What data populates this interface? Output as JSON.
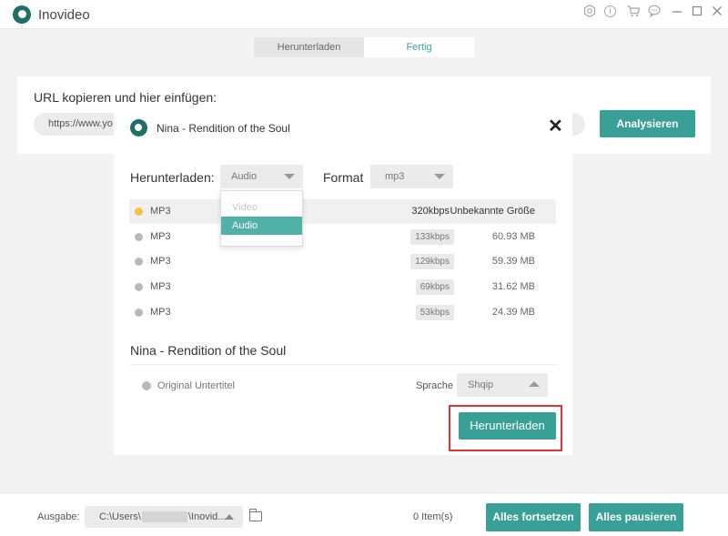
{
  "app": {
    "title": "Inovideo",
    "brand_color": "#39a097",
    "window_icons": [
      "settings-icon",
      "info-icon",
      "cart-icon",
      "feedback-icon",
      "minimize-icon",
      "maximize-icon",
      "close-icon"
    ]
  },
  "tabs": [
    {
      "label": "Herunterladen",
      "active": false
    },
    {
      "label": "Fertig",
      "active": true
    }
  ],
  "url_panel": {
    "label": "URL kopieren und hier einfügen:",
    "url_value": "https://www.yo",
    "analyze_label": "Analysieren"
  },
  "dialog": {
    "title": "Nina - Rendition of the Soul",
    "download_label": "Herunterladen:",
    "type_select": "Audio",
    "type_options": [
      "Video",
      "Audio"
    ],
    "format_label": "Format",
    "format_select": "mp3",
    "rows": [
      {
        "format": "MP3",
        "bitrate": "320kbps",
        "size": "Unbekannte Größe",
        "selected": true
      },
      {
        "format": "MP3",
        "bitrate": "133kbps",
        "size": "60.93 MB",
        "selected": false
      },
      {
        "format": "MP3",
        "bitrate": "129kbps",
        "size": "59.39 MB",
        "selected": false
      },
      {
        "format": "MP3",
        "bitrate": "69kbps",
        "size": "31.62 MB",
        "selected": false
      },
      {
        "format": "MP3",
        "bitrate": "53kbps",
        "size": "24.39 MB",
        "selected": false
      }
    ],
    "song_name": "Nina - Rendition of the Soul",
    "subtitle_label": "Original Untertitel",
    "language_label": "Sprache",
    "language_value": "Shqip",
    "download_button": "Herunterladen"
  },
  "footer": {
    "output_label": "Ausgabe:",
    "path_prefix": "C:\\Users\\",
    "path_suffix": "\\Inovid...",
    "items_count": "0 Item(s)",
    "resume_all": "Alles fortsetzen",
    "pause_all": "Alles pausieren"
  }
}
